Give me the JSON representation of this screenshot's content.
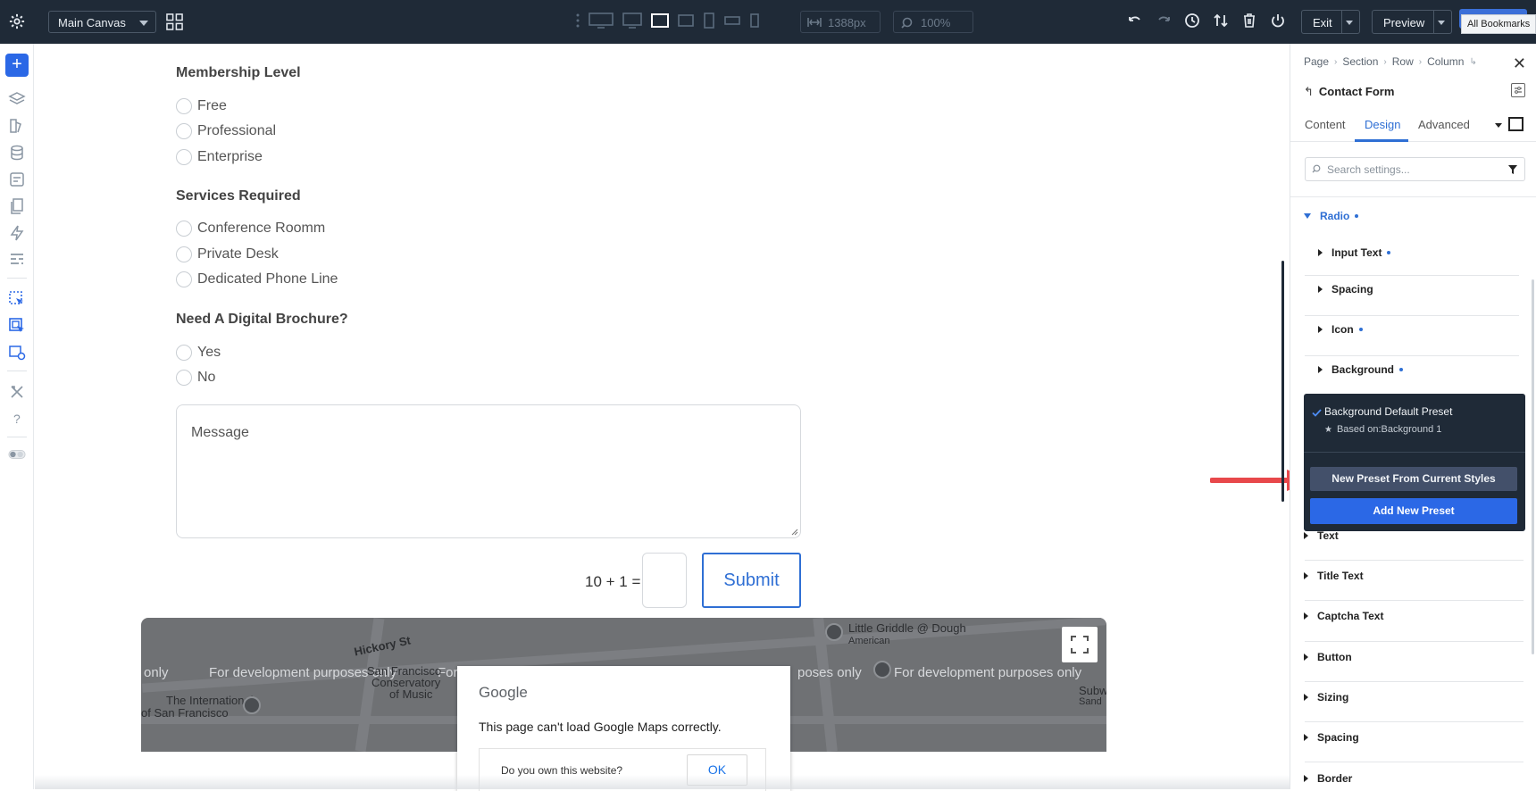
{
  "topbar": {
    "canvas_label": "Main Canvas",
    "width_value": "1388px",
    "zoom_value": "100%",
    "exit_label": "Exit",
    "preview_label": "Preview",
    "bookmarks_label": "All Bookmarks"
  },
  "form": {
    "membership": {
      "title": "Membership Level",
      "options": [
        "Free",
        "Professional",
        "Enterprise"
      ]
    },
    "services": {
      "title": "Services Required",
      "options": [
        "Conference Roomm",
        "Private Desk",
        "Dedicated Phone Line"
      ]
    },
    "brochure": {
      "title": "Need A Digital Brochure?",
      "options": [
        "Yes",
        "No"
      ]
    },
    "message_placeholder": "Message",
    "captcha_label": "10 + 1 =",
    "submit_label": "Submit"
  },
  "map": {
    "dev_text": "For development purposes only",
    "dev_text_left": "only",
    "dev_text_partial": "For",
    "dev_text_right": "poses only",
    "streets": {
      "hickory": "Hickory St",
      "conservatory_1": "San Francisco",
      "conservatory_2": "Conservatory",
      "conservatory_3": "of Music",
      "international_1": "The International",
      "international_2": "of San Francisco",
      "griddle_1": "Little Griddle @ Dough",
      "griddle_2": "American",
      "subw_1": "Subw",
      "subw_2": "Sand"
    },
    "dialog": {
      "logo": "Google",
      "message": "This page can't load Google Maps correctly.",
      "question": "Do you own this website?",
      "ok": "OK"
    }
  },
  "panel": {
    "breadcrumbs": [
      "Page",
      "Section",
      "Row",
      "Column"
    ],
    "module_title": "Contact Form",
    "tabs": [
      "Content",
      "Design",
      "Advanced"
    ],
    "active_tab": "Design",
    "search_placeholder": "Search settings...",
    "open_group": "Radio",
    "sub_groups": [
      "Input Text",
      "Spacing",
      "Icon",
      "Background"
    ],
    "groups": [
      "Text",
      "Title Text",
      "Captcha Text",
      "Button",
      "Sizing",
      "Spacing",
      "Border"
    ]
  },
  "preset_menu": {
    "preset_name": "Background Default Preset",
    "based_on": "Based on:Background 1",
    "new_preset_label": "New Preset From Current Styles",
    "add_preset_label": "Add New Preset"
  },
  "colors": {
    "topbar_bg": "#1f2a37",
    "accent": "#2f6fd4",
    "add_button": "#2b68e6",
    "arrow": "#e8484b"
  }
}
